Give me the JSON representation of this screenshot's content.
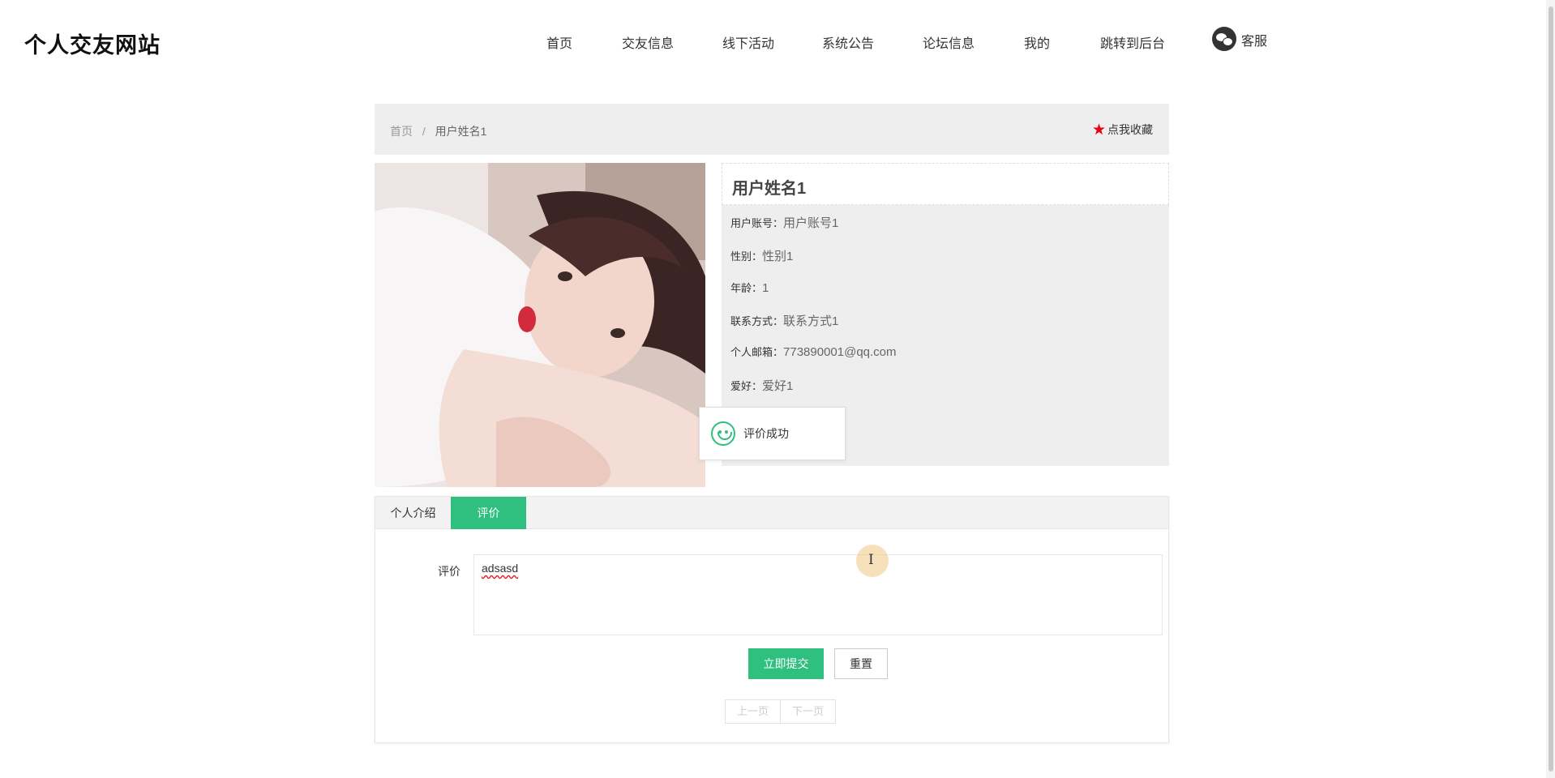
{
  "site": {
    "title": "个人交友网站"
  },
  "nav": {
    "items": [
      {
        "label": "首页"
      },
      {
        "label": "交友信息"
      },
      {
        "label": "线下活动"
      },
      {
        "label": "系统公告"
      },
      {
        "label": "论坛信息"
      },
      {
        "label": "我的"
      },
      {
        "label": "跳转到后台"
      }
    ],
    "service_label": "客服",
    "service_icon": "wechat-icon"
  },
  "breadcrumb": {
    "home": "首页",
    "separator": "/",
    "current": "用户姓名1",
    "favorite_label": "点我收藏",
    "favorite_icon": "star-icon",
    "favorite_color": "#e60012"
  },
  "profile": {
    "name": "用户姓名1",
    "fields": [
      {
        "label": "用户账号：",
        "value": "用户账号1"
      },
      {
        "label": "性别：",
        "value": "性别1"
      },
      {
        "label": "年龄：",
        "value": "1"
      },
      {
        "label": "联系方式：",
        "value": "联系方式1"
      },
      {
        "label": "个人邮箱：",
        "value": "773890001@qq.com"
      },
      {
        "label": "爱好：",
        "value": "爱好1"
      }
    ]
  },
  "toast": {
    "message": "评价成功",
    "icon": "smile-icon"
  },
  "tabs": [
    {
      "label": "个人介绍",
      "active": false
    },
    {
      "label": "评价",
      "active": true
    }
  ],
  "comment_form": {
    "label": "评价",
    "value": "adsasd",
    "submit_label": "立即提交",
    "reset_label": "重置"
  },
  "pager": {
    "prev_label": "上一页",
    "next_label": "下一页"
  },
  "colors": {
    "accent": "#2fbf7f",
    "panel_bg": "#eeeeee"
  }
}
